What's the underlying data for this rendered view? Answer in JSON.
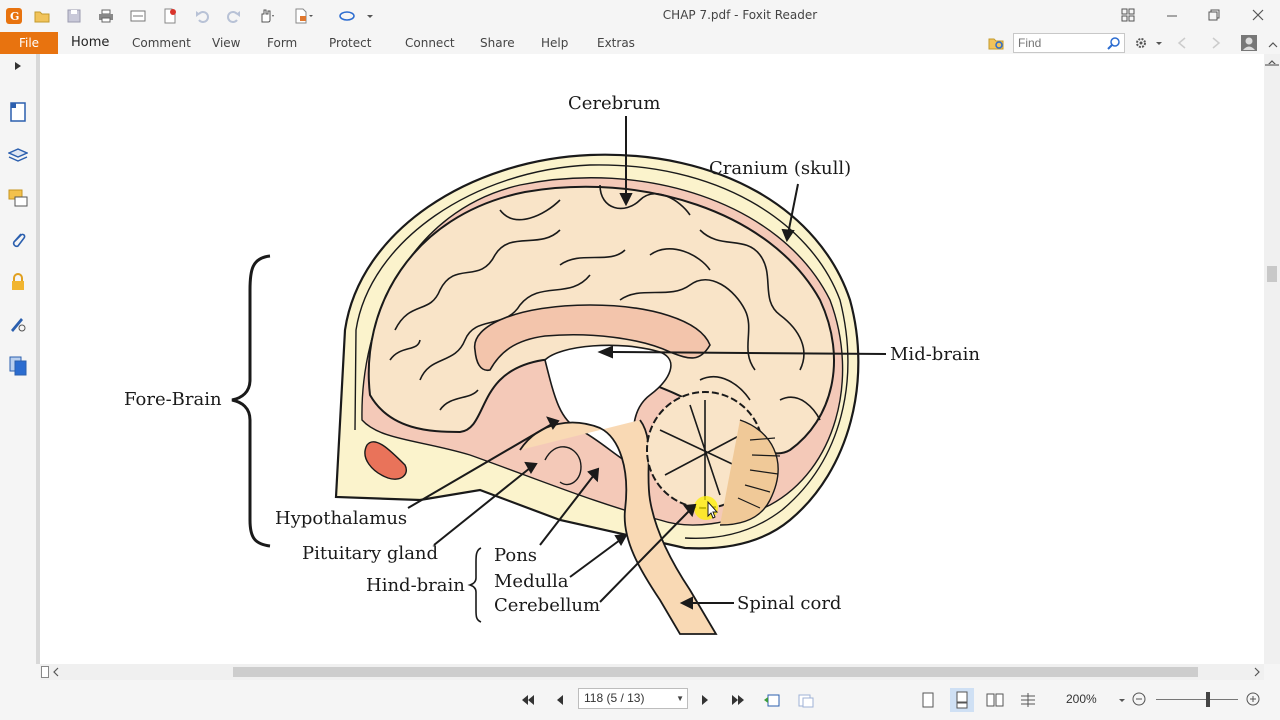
{
  "window": {
    "title": "CHAP 7.pdf - Foxit Reader"
  },
  "ribbon": {
    "file_label": "File",
    "tabs": [
      "Home",
      "Comment",
      "View",
      "Form",
      "Protect",
      "Connect",
      "Share",
      "Help",
      "Extras"
    ],
    "active_tab": "Home",
    "find_placeholder": "Find"
  },
  "diagram": {
    "labels": {
      "cerebrum": "Cerebrum",
      "cranium": "Cranium (skull)",
      "mid_brain": "Mid-brain",
      "fore_brain": "Fore-Brain",
      "hypothalamus": "Hypothalamus",
      "pituitary": "Pituitary gland",
      "pons": "Pons",
      "hind_brain": "Hind-brain",
      "medulla": "Medulla",
      "cerebellum": "Cerebellum",
      "spinal_cord": "Spinal cord"
    }
  },
  "statusbar": {
    "page_value": "118 (5 / 13)",
    "zoom": "200%"
  },
  "colors": {
    "accent": "#e8730f",
    "brain_fill": "#f9e4c8",
    "skull_fill": "#fbf3cc",
    "membrane_fill": "#f4c9b8",
    "highlight": "#fff000"
  }
}
